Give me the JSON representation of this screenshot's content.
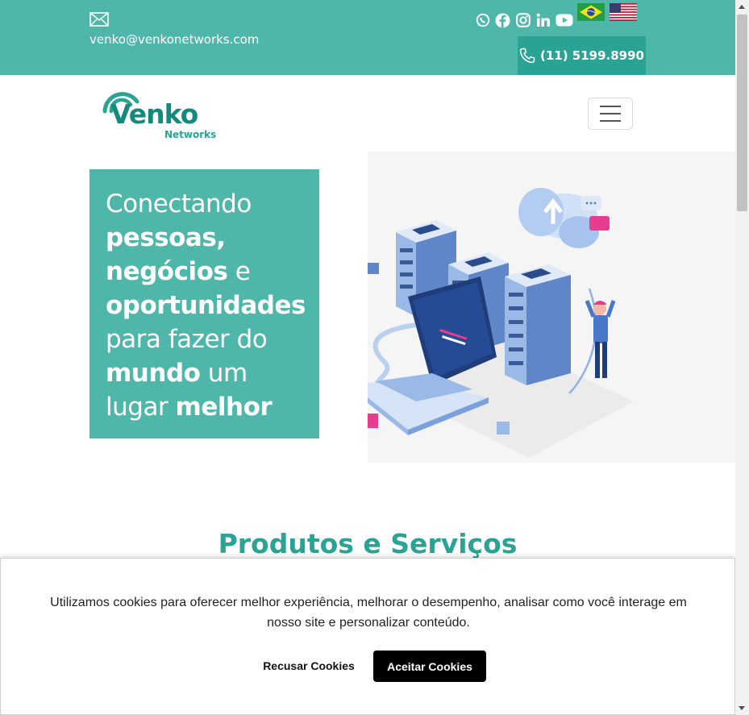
{
  "topbar": {
    "email": "venko@venkonetworks.com",
    "phone": "(11) 5199.8990",
    "social_icons": [
      "whatsapp-icon",
      "facebook-icon",
      "instagram-icon",
      "linkedin-icon",
      "youtube-icon"
    ],
    "languages": [
      "pt-BR flag",
      "en-US flag"
    ]
  },
  "logo": {
    "name": "Venko",
    "tagline": "Networks"
  },
  "hero": {
    "line1": "Conectando",
    "bold1": "pessoas,",
    "bold2": "negócios",
    "plain2": " e",
    "bold3": "oportunidades",
    "line4": "para fazer do",
    "bold4": "mundo",
    "plain4": " um",
    "plain5": "lugar ",
    "bold5": "melhor"
  },
  "section": {
    "title": "Produtos e Serviços"
  },
  "cookie": {
    "message": "Utilizamos cookies para oferecer melhor experiência, melhorar o desempenho, analisar como você interage em nosso site e personalizar conteúdo.",
    "decline_label": "Recusar Cookies",
    "accept_label": "Aceitar Cookies"
  },
  "colors": {
    "brand": "#4fb6aa",
    "brand_dark": "#2aa394",
    "logo": "#138a7c"
  }
}
